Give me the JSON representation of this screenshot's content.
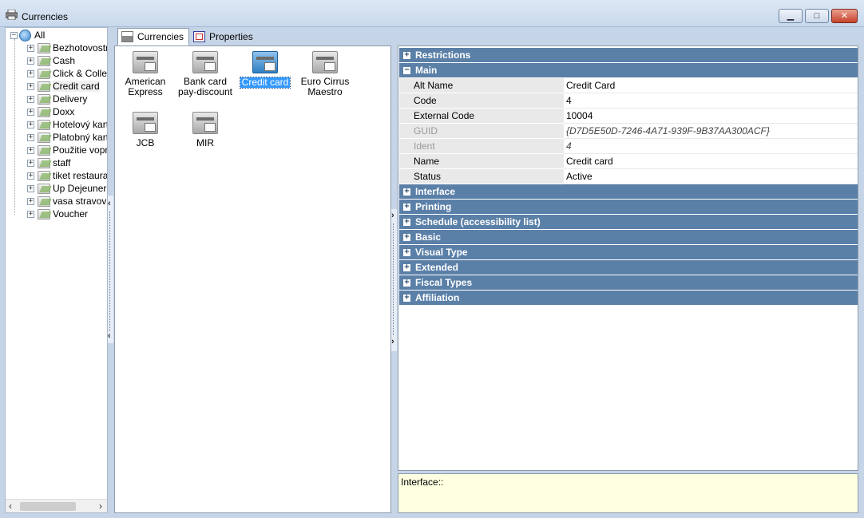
{
  "window": {
    "title": "Currencies",
    "buttons": [
      "minimize",
      "maximize",
      "close"
    ]
  },
  "tree": {
    "root": "All",
    "items": [
      "Bezhotovostr",
      "Cash",
      "Click & Collec",
      "Credit card",
      "Delivery",
      "Doxx",
      "Hotelový kart",
      "Platobný kart",
      "Použitie vopr",
      "staff",
      "tiket restaurar",
      "Up Dejeuner",
      "vasa stravova",
      "Voucher"
    ],
    "selected": "Credit card"
  },
  "tabs": [
    {
      "label": "Currencies",
      "active": true
    },
    {
      "label": "Properties",
      "active": false
    }
  ],
  "currencies": [
    {
      "line1": "American",
      "line2": "Express",
      "selected": false
    },
    {
      "line1": "Bank card",
      "line2": "pay-discount",
      "selected": false
    },
    {
      "line1": "Credit card",
      "line2": "",
      "selected": true
    },
    {
      "line1": "Euro Cirrus",
      "line2": "Maestro",
      "selected": false
    },
    {
      "line1": "JCB",
      "line2": "",
      "selected": false
    },
    {
      "line1": "MIR",
      "line2": "",
      "selected": false
    }
  ],
  "property_grid": {
    "categories_top": [
      {
        "label": "Restrictions",
        "expanded": false
      },
      {
        "label": "Main",
        "expanded": true
      }
    ],
    "main_rows": [
      {
        "name": "Alt Name",
        "value": "Credit Card",
        "disabled": false
      },
      {
        "name": "Code",
        "value": "4",
        "disabled": false
      },
      {
        "name": "External Code",
        "value": "10004",
        "disabled": false
      },
      {
        "name": "GUID",
        "value": "{D7D5E50D-7246-4A71-939F-9B37AA300ACF}",
        "disabled": true
      },
      {
        "name": "Ident",
        "value": "4",
        "disabled": true
      },
      {
        "name": "Name",
        "value": "Credit card",
        "disabled": false
      },
      {
        "name": "Status",
        "value": "Active",
        "disabled": false
      }
    ],
    "categories_bottom": [
      {
        "label": "Interface",
        "expanded": false
      },
      {
        "label": "Printing",
        "expanded": false
      },
      {
        "label": "Schedule (accessibility list)",
        "expanded": false
      },
      {
        "label": "Basic",
        "expanded": false
      },
      {
        "label": "Visual Type",
        "expanded": false
      },
      {
        "label": "Extended",
        "expanded": false
      },
      {
        "label": "Fiscal Types",
        "expanded": false
      },
      {
        "label": "Affiliation",
        "expanded": false
      }
    ]
  },
  "description": {
    "text": "Interface::"
  },
  "glyphs": {
    "plus": "+",
    "minus": "−",
    "left": "‹",
    "right": "›",
    "minimize": "▁",
    "maximize": "□",
    "close": "✕"
  },
  "colors": {
    "category_bar": "#5b80a8",
    "selection": "#3399ff",
    "description_bg": "#ffffe1"
  }
}
